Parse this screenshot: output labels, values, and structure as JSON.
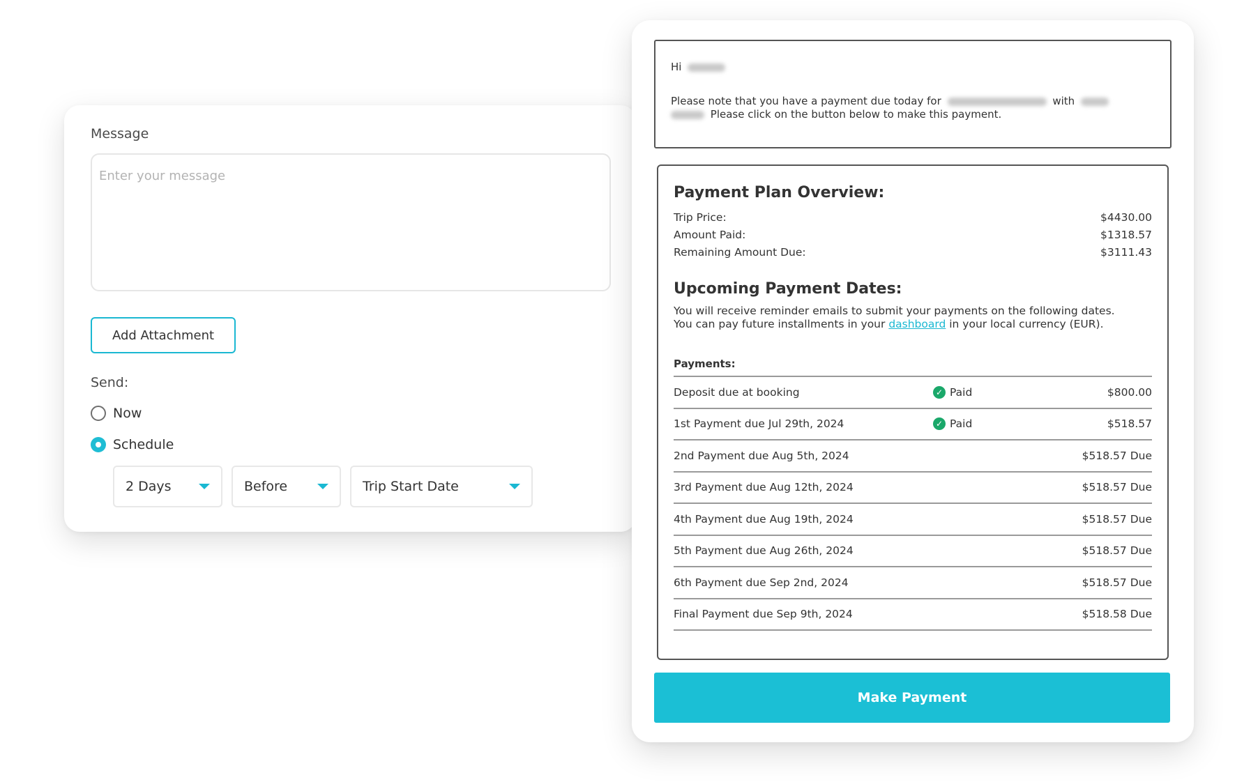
{
  "compose": {
    "message_label": "Message",
    "message_placeholder": "Enter your message",
    "attachment_button": "Add Attachment",
    "send_label": "Send:",
    "send_options": [
      {
        "label": "Now",
        "selected": false
      },
      {
        "label": "Schedule",
        "selected": true
      }
    ],
    "schedule": {
      "amount": "2 Days",
      "relation": "Before",
      "reference": "Trip Start Date"
    }
  },
  "email": {
    "greeting": "Hi",
    "body_part1": "Please note that you have a payment due today for",
    "body_with": "with",
    "body_part2": "Please click on the button below to make this payment.",
    "overview_title": "Payment Plan Overview:",
    "summary": [
      {
        "label": "Trip Price:",
        "value": "$4430.00"
      },
      {
        "label": "Amount Paid:",
        "value": "$1318.57"
      },
      {
        "label": "Remaining Amount Due:",
        "value": "$3111.43"
      }
    ],
    "upcoming_title": "Upcoming Payment Dates:",
    "upcoming_line1": "You will receive reminder emails to submit your payments on the following dates.",
    "upcoming_line2_before": "You can pay future installments in your",
    "upcoming_link": "dashboard",
    "upcoming_line2_after": "in your local currency (EUR).",
    "payments_header": "Payments:",
    "payments": [
      {
        "name": "Deposit due at booking",
        "status": "Paid",
        "amount": "$800.00"
      },
      {
        "name": "1st Payment due Jul 29th, 2024",
        "status": "Paid",
        "amount": "$518.57"
      },
      {
        "name": "2nd Payment due Aug 5th, 2024",
        "status": "",
        "amount": "$518.57 Due"
      },
      {
        "name": "3rd Payment due Aug 12th, 2024",
        "status": "",
        "amount": "$518.57 Due"
      },
      {
        "name": "4th Payment due Aug 19th, 2024",
        "status": "",
        "amount": "$518.57 Due"
      },
      {
        "name": "5th Payment due Aug 26th, 2024",
        "status": "",
        "amount": "$518.57 Due"
      },
      {
        "name": "6th Payment due Sep 2nd, 2024",
        "status": "",
        "amount": "$518.57 Due"
      },
      {
        "name": "Final Payment due Sep 9th, 2024",
        "status": "",
        "amount": "$518.58 Due"
      }
    ],
    "make_payment_button": "Make Payment"
  },
  "colors": {
    "accent": "#1bbfd5",
    "paid_check": "#1aa86a",
    "border": "#555555"
  },
  "icons": {
    "paid": "check-circle-icon",
    "dropdown": "caret-down-icon"
  }
}
